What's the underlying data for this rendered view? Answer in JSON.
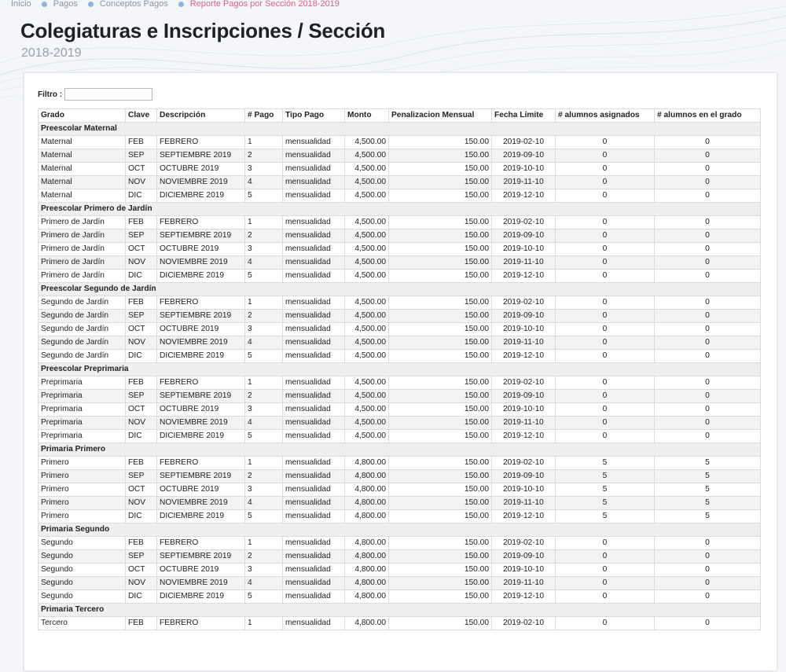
{
  "breadcrumb": {
    "items": [
      "Inicio",
      "Pagos",
      "Conceptos Pagos",
      "Reporte Pagos por Sección 2018-2019"
    ]
  },
  "header": {
    "title": "Colegiaturas e Inscripciones / Sección",
    "subtitle": "2018-2019"
  },
  "filter": {
    "label": "Filtro :",
    "value": ""
  },
  "table": {
    "columns": [
      "Grado",
      "Clave",
      "Descripción",
      "# Pago",
      "Tipo Pago",
      "Monto",
      "Penalizacion Mensual",
      "Fecha Límite",
      "# alumnos asignados",
      "# alumnos en el grado"
    ],
    "groups": [
      {
        "name": "Preescolar Maternal",
        "rows": [
          [
            "Maternal",
            "FEB",
            "FEBRERO",
            "1",
            "mensualidad",
            "4,500.00",
            "150.00",
            "2019-02-10",
            "0",
            "0"
          ],
          [
            "Maternal",
            "SEP",
            "SEPTIEMBRE 2019",
            "2",
            "mensualidad",
            "4,500.00",
            "150.00",
            "2019-09-10",
            "0",
            "0"
          ],
          [
            "Maternal",
            "OCT",
            "OCTUBRE 2019",
            "3",
            "mensualidad",
            "4,500.00",
            "150.00",
            "2019-10-10",
            "0",
            "0"
          ],
          [
            "Maternal",
            "NOV",
            "NOVIEMBRE 2019",
            "4",
            "mensualidad",
            "4,500.00",
            "150.00",
            "2019-11-10",
            "0",
            "0"
          ],
          [
            "Maternal",
            "DIC",
            "DICIEMBRE 2019",
            "5",
            "mensualidad",
            "4,500.00",
            "150.00",
            "2019-12-10",
            "0",
            "0"
          ]
        ]
      },
      {
        "name": "Preescolar Primero de Jardín",
        "rows": [
          [
            "Primero de Jardín",
            "FEB",
            "FEBRERO",
            "1",
            "mensualidad",
            "4,500.00",
            "150.00",
            "2019-02-10",
            "0",
            "0"
          ],
          [
            "Primero de Jardín",
            "SEP",
            "SEPTIEMBRE 2019",
            "2",
            "mensualidad",
            "4,500.00",
            "150.00",
            "2019-09-10",
            "0",
            "0"
          ],
          [
            "Primero de Jardín",
            "OCT",
            "OCTUBRE 2019",
            "3",
            "mensualidad",
            "4,500.00",
            "150.00",
            "2019-10-10",
            "0",
            "0"
          ],
          [
            "Primero de Jardín",
            "NOV",
            "NOVIEMBRE 2019",
            "4",
            "mensualidad",
            "4,500.00",
            "150.00",
            "2019-11-10",
            "0",
            "0"
          ],
          [
            "Primero de Jardín",
            "DIC",
            "DICIEMBRE 2019",
            "5",
            "mensualidad",
            "4,500.00",
            "150.00",
            "2019-12-10",
            "0",
            "0"
          ]
        ]
      },
      {
        "name": "Preescolar Segundo de Jardín",
        "rows": [
          [
            "Segundo de Jardín",
            "FEB",
            "FEBRERO",
            "1",
            "mensualidad",
            "4,500.00",
            "150.00",
            "2019-02-10",
            "0",
            "0"
          ],
          [
            "Segundo de Jardín",
            "SEP",
            "SEPTIEMBRE 2019",
            "2",
            "mensualidad",
            "4,500.00",
            "150.00",
            "2019-09-10",
            "0",
            "0"
          ],
          [
            "Segundo de Jardín",
            "OCT",
            "OCTUBRE 2019",
            "3",
            "mensualidad",
            "4,500.00",
            "150.00",
            "2019-10-10",
            "0",
            "0"
          ],
          [
            "Segundo de Jardín",
            "NOV",
            "NOVIEMBRE 2019",
            "4",
            "mensualidad",
            "4,500.00",
            "150.00",
            "2019-11-10",
            "0",
            "0"
          ],
          [
            "Segundo de Jardín",
            "DIC",
            "DICIEMBRE 2019",
            "5",
            "mensualidad",
            "4,500.00",
            "150.00",
            "2019-12-10",
            "0",
            "0"
          ]
        ]
      },
      {
        "name": "Preescolar Preprimaria",
        "rows": [
          [
            "Preprimaria",
            "FEB",
            "FEBRERO",
            "1",
            "mensualidad",
            "4,500.00",
            "150.00",
            "2019-02-10",
            "0",
            "0"
          ],
          [
            "Preprimaria",
            "SEP",
            "SEPTIEMBRE 2019",
            "2",
            "mensualidad",
            "4,500.00",
            "150.00",
            "2019-09-10",
            "0",
            "0"
          ],
          [
            "Preprimaria",
            "OCT",
            "OCTUBRE 2019",
            "3",
            "mensualidad",
            "4,500.00",
            "150.00",
            "2019-10-10",
            "0",
            "0"
          ],
          [
            "Preprimaria",
            "NOV",
            "NOVIEMBRE 2019",
            "4",
            "mensualidad",
            "4,500.00",
            "150.00",
            "2019-11-10",
            "0",
            "0"
          ],
          [
            "Preprimaria",
            "DIC",
            "DICIEMBRE 2019",
            "5",
            "mensualidad",
            "4,500.00",
            "150.00",
            "2019-12-10",
            "0",
            "0"
          ]
        ]
      },
      {
        "name": "Primaria Primero",
        "rows": [
          [
            "Primero",
            "FEB",
            "FEBRERO",
            "1",
            "mensualidad",
            "4,800.00",
            "150.00",
            "2019-02-10",
            "5",
            "5"
          ],
          [
            "Primero",
            "SEP",
            "SEPTIEMBRE 2019",
            "2",
            "mensualidad",
            "4,800.00",
            "150.00",
            "2019-09-10",
            "5",
            "5"
          ],
          [
            "Primero",
            "OCT",
            "OCTUBRE 2019",
            "3",
            "mensualidad",
            "4,800.00",
            "150.00",
            "2019-10-10",
            "5",
            "5"
          ],
          [
            "Primero",
            "NOV",
            "NOVIEMBRE 2019",
            "4",
            "mensualidad",
            "4,800.00",
            "150.00",
            "2019-11-10",
            "5",
            "5"
          ],
          [
            "Primero",
            "DIC",
            "DICIEMBRE 2019",
            "5",
            "mensualidad",
            "4,800.00",
            "150.00",
            "2019-12-10",
            "5",
            "5"
          ]
        ]
      },
      {
        "name": "Primaria Segundo",
        "rows": [
          [
            "Segundo",
            "FEB",
            "FEBRERO",
            "1",
            "mensualidad",
            "4,800.00",
            "150.00",
            "2019-02-10",
            "0",
            "0"
          ],
          [
            "Segundo",
            "SEP",
            "SEPTIEMBRE 2019",
            "2",
            "mensualidad",
            "4,800.00",
            "150.00",
            "2019-09-10",
            "0",
            "0"
          ],
          [
            "Segundo",
            "OCT",
            "OCTUBRE 2019",
            "3",
            "mensualidad",
            "4,800.00",
            "150.00",
            "2019-10-10",
            "0",
            "0"
          ],
          [
            "Segundo",
            "NOV",
            "NOVIEMBRE 2019",
            "4",
            "mensualidad",
            "4,800.00",
            "150.00",
            "2019-11-10",
            "0",
            "0"
          ],
          [
            "Segundo",
            "DIC",
            "DICIEMBRE 2019",
            "5",
            "mensualidad",
            "4,800.00",
            "150.00",
            "2019-12-10",
            "0",
            "0"
          ]
        ]
      },
      {
        "name": "Primaria Tercero",
        "rows": [
          [
            "Tercero",
            "FEB",
            "FEBRERO",
            "1",
            "mensualidad",
            "4,800.00",
            "150.00",
            "2019-02-10",
            "0",
            "0"
          ]
        ]
      }
    ]
  }
}
